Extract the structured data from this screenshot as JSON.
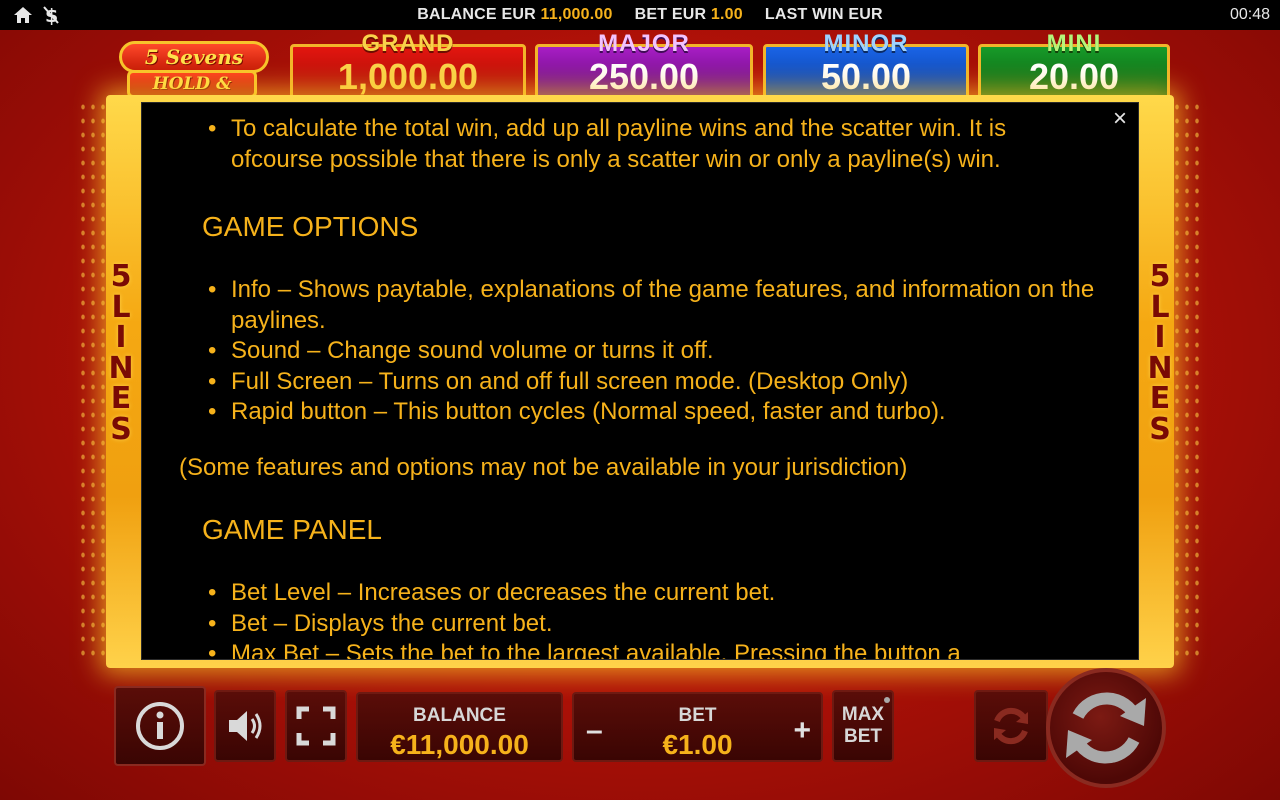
{
  "status_bar": {
    "balance_label": "BALANCE EUR",
    "balance_value": "11,000.00",
    "bet_label": "BET EUR",
    "bet_value": "1.00",
    "last_win_label": "LAST WIN EUR",
    "clock": "00:48"
  },
  "logo": {
    "line1": "5 Sevens",
    "line2": "HOLD & WIN"
  },
  "jackpots": {
    "grand": {
      "label": "GRAND",
      "amount": "1,000.00"
    },
    "major": {
      "label": "MAJOR",
      "amount": "250.00"
    },
    "minor": {
      "label": "MINOR",
      "amount": "50.00"
    },
    "mini": {
      "label": "MINI",
      "amount": "20.00"
    }
  },
  "side_label": [
    "5",
    "L",
    "I",
    "N",
    "E",
    "S"
  ],
  "help": {
    "close": "×",
    "top_bullet": "To calculate the total win, add up all payline wins and the scatter win. It is ofcourse possible that there is only a scatter win or only a payline(s) win.",
    "options_heading": "GAME OPTIONS",
    "options": [
      "Info – Shows paytable, explanations of the game features, and information on the paylines.",
      "Sound – Change sound volume or turns it off.",
      "Full Screen – Turns on and off full screen mode. (Desktop Only)",
      "Rapid button – This button cycles (Normal speed, faster and turbo)."
    ],
    "jurisdiction_note": "(Some features and options may not be available in your jurisdiction)",
    "panel_heading": "GAME PANEL",
    "panel_items": [
      "Bet Level – Increases or decreases the current bet.",
      "Bet – Displays the current bet.",
      "Max Bet – Sets the bet to the largest available. Pressing the button a"
    ]
  },
  "controls": {
    "balance_label": "BALANCE",
    "balance_value": "€11,000.00",
    "bet_label": "BET",
    "bet_value": "€1.00",
    "bet_minus": "–",
    "bet_plus": "+",
    "max_bet_line1": "MAX",
    "max_bet_line2": "BET"
  },
  "icons": [
    "home-icon",
    "dollar-icon",
    "close-icon",
    "info-icon",
    "speaker-icon",
    "fullscreen-icon",
    "autoplay-icon",
    "spin-icon"
  ]
}
